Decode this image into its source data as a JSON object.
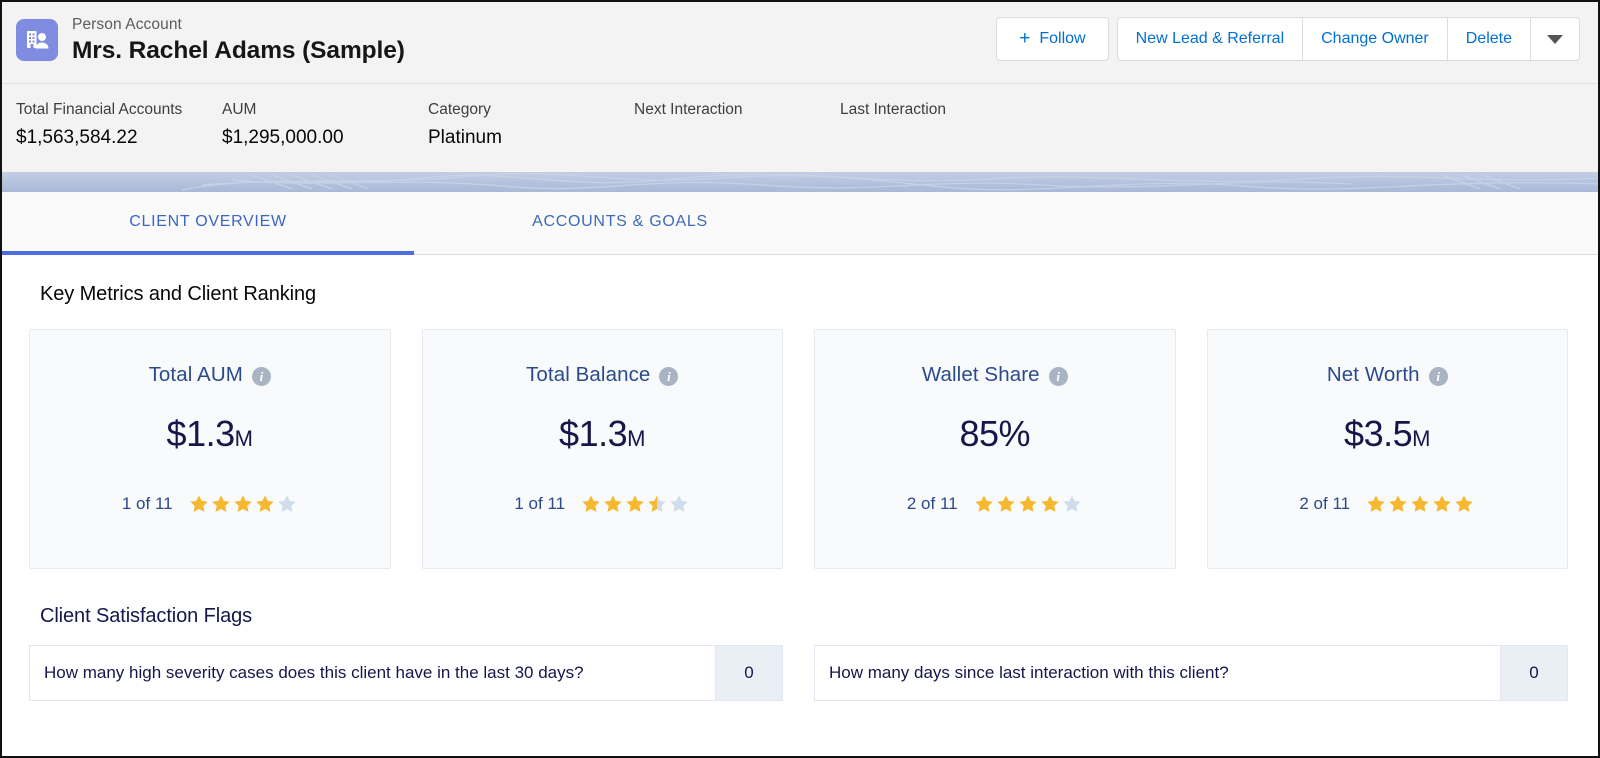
{
  "header": {
    "record_type": "Person Account",
    "record_name": "Mrs. Rachel Adams (Sample)",
    "entity_icon": "person-account-icon",
    "actions": {
      "follow": "Follow",
      "new_lead_referral": "New Lead & Referral",
      "change_owner": "Change Owner",
      "delete": "Delete",
      "more_caret": "chevron-down-icon"
    }
  },
  "highlights": [
    {
      "label": "Total Financial Accounts",
      "value": "$1,563,584.22"
    },
    {
      "label": "AUM",
      "value": "$1,295,000.00"
    },
    {
      "label": "Category",
      "value": "Platinum"
    },
    {
      "label": "Next Interaction",
      "value": ""
    },
    {
      "label": "Last Interaction",
      "value": ""
    }
  ],
  "tabs": [
    {
      "label": "CLIENT OVERVIEW",
      "active": true
    },
    {
      "label": "ACCOUNTS & GOALS",
      "active": false
    }
  ],
  "sections": {
    "key_metrics_title": "Key Metrics and Client Ranking",
    "satisfaction_title": "Client Satisfaction Flags"
  },
  "metrics": [
    {
      "label": "Total AUM",
      "value": "$1.3",
      "value_suffix": "M",
      "rank": "1 of 11",
      "stars_filled": 4,
      "stars_total": 5
    },
    {
      "label": "Total Balance",
      "value": "$1.3",
      "value_suffix": "M",
      "rank": "1 of 11",
      "stars_filled": 3.5,
      "stars_total": 5
    },
    {
      "label": "Wallet Share",
      "value": "85%",
      "value_suffix": "",
      "rank": "2 of 11",
      "stars_filled": 4,
      "stars_total": 5
    },
    {
      "label": "Net Worth",
      "value": "$3.5",
      "value_suffix": "M",
      "rank": "2 of 11",
      "stars_filled": 5,
      "stars_total": 5
    }
  ],
  "satisfaction_flags": [
    {
      "question": "How many high severity cases does this client have in the last 30 days?",
      "value": "0"
    },
    {
      "question": "How many days since last interaction with this client?",
      "value": "0"
    }
  ],
  "colors": {
    "brand_blue": "#0070d2",
    "tab_blue": "#3c65c4",
    "star_gold": "#f5b82e",
    "star_empty": "#cfdcec",
    "metric_label": "#2b4a8b",
    "icon_purple": "#7f8ce0",
    "banner": "#b5c3de"
  }
}
